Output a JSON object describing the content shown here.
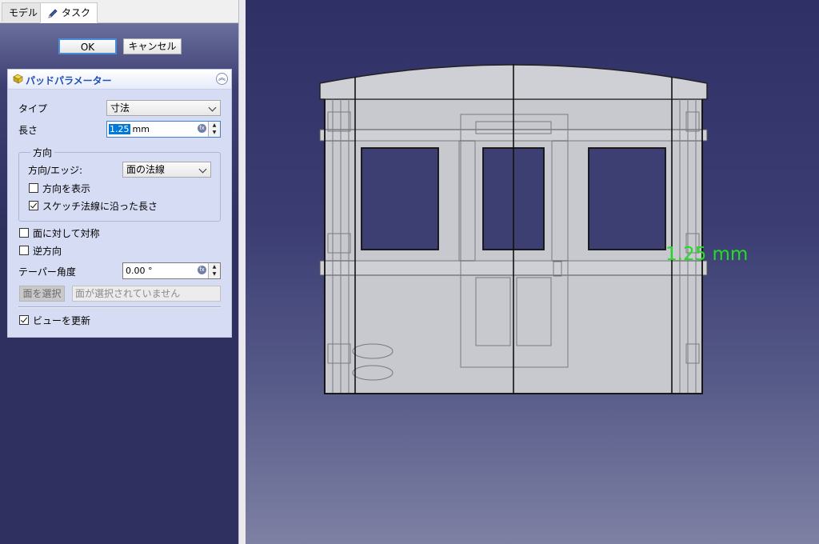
{
  "tabs": {
    "model": "モデル",
    "task": "タスク"
  },
  "dialog": {
    "ok": "OK",
    "cancel": "キャンセル"
  },
  "pad": {
    "title": "パッドパラメーター",
    "type_label": "タイプ",
    "type_value": "寸法",
    "length_label": "長さ",
    "length_value": "1.25",
    "length_unit": "mm",
    "direction_group": "方向",
    "direction_edge_label": "方向/エッジ:",
    "direction_edge_value": "面の法線",
    "show_direction": "方向を表示",
    "along_sketch_normal": "スケッチ法線に沿った長さ",
    "symmetric": "面に対して対称",
    "reversed": "逆方向",
    "taper_label": "テーパー角度",
    "taper_value": "0.00 °",
    "select_face_button": "面を選択",
    "no_face_selected": "面が選択されていません",
    "update_view": "ビューを更新"
  },
  "viewport": {
    "dimension_label": "1.25 mm"
  },
  "colors": {
    "accent": "#0078d7",
    "dimension": "#22dd22"
  },
  "icons": [
    "pencil-icon",
    "pad-icon",
    "collapse-icon",
    "expression-icon"
  ]
}
